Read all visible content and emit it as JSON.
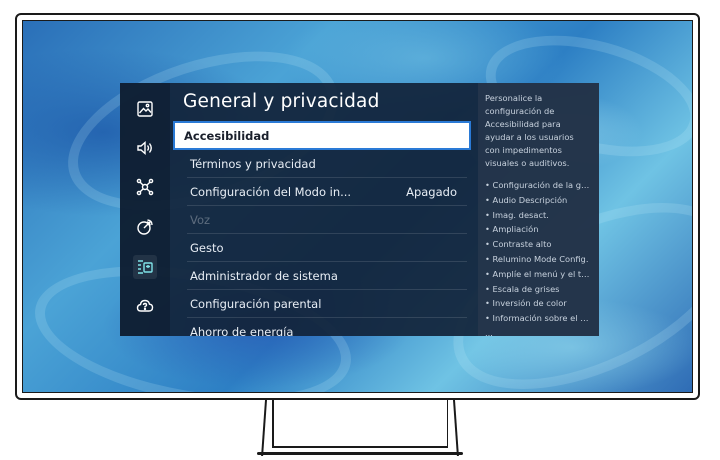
{
  "menu": {
    "title": "General y privacidad",
    "items": [
      {
        "label": "Accesibilidad",
        "value": "",
        "state": "selected"
      },
      {
        "label": "Términos y privacidad",
        "value": "",
        "state": "normal"
      },
      {
        "label": "Configuración del Modo in...",
        "value": "Apagado",
        "state": "normal"
      },
      {
        "label": "Voz",
        "value": "",
        "state": "disabled"
      },
      {
        "label": "Gesto",
        "value": "",
        "state": "normal"
      },
      {
        "label": "Administrador de sistema",
        "value": "",
        "state": "normal"
      },
      {
        "label": "Configuración parental",
        "value": "",
        "state": "normal"
      },
      {
        "label": "Ahorro de energía",
        "value": "",
        "state": "normal"
      }
    ]
  },
  "sidebar": {
    "icons": [
      {
        "name": "picture-icon"
      },
      {
        "name": "sound-icon"
      },
      {
        "name": "connection-icon"
      },
      {
        "name": "support-signal-icon"
      },
      {
        "name": "general-privacy-icon",
        "active": true
      },
      {
        "name": "support-cloud-icon"
      }
    ]
  },
  "info": {
    "description": "Personalice la configuración de Accesibilidad para ayudar a los usuarios con impedimentos visuales o auditivos.",
    "items": [
      "• Configuración de la guí...",
      "• Audio Descripción",
      "• Imag. desact.",
      "• Ampliación",
      "• Contraste alto",
      "• Relumino Mode Config.",
      "• Amplíe el menú y el tex...",
      "• Escala de grises",
      "• Inversión de color",
      "• Información sobre el co...",
      "..."
    ]
  },
  "colors": {
    "panel": "#12243a",
    "selection_border": "#2a7ad6",
    "screen_blue": "#2a6fb8"
  }
}
